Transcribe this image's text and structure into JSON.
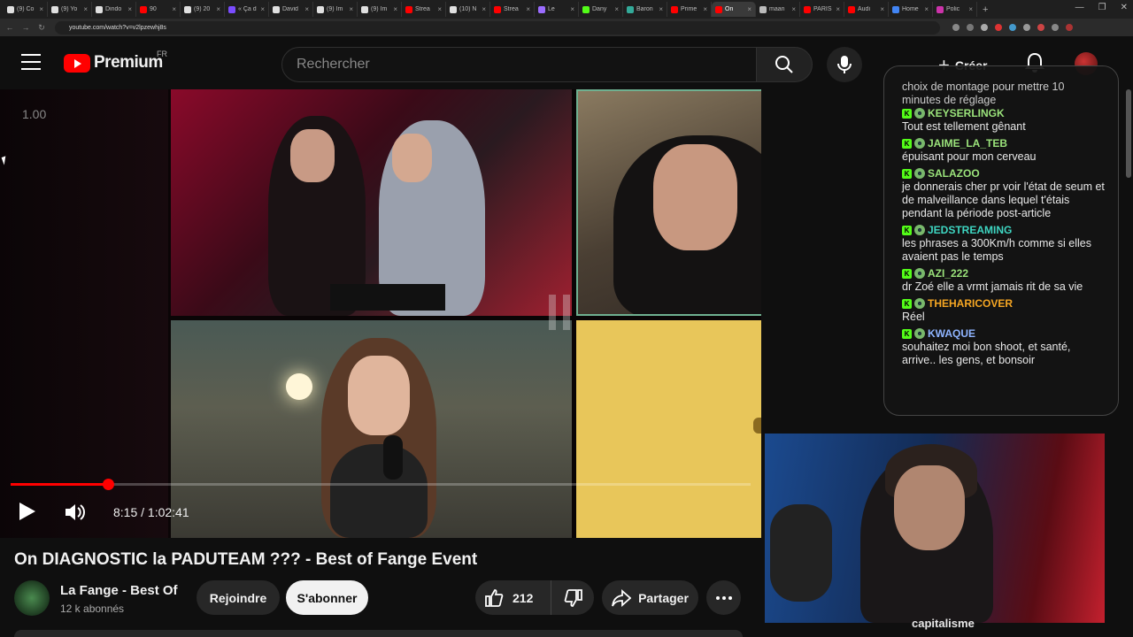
{
  "browser": {
    "tabs": [
      {
        "title": "(9) Co",
        "color": "#e0e0e0"
      },
      {
        "title": "(9) Yo",
        "color": "#e0e0e0"
      },
      {
        "title": "Dindo",
        "color": "#e0e0e0"
      },
      {
        "title": "90",
        "color": "#ff0000"
      },
      {
        "title": "(9) 20",
        "color": "#e0e0e0"
      },
      {
        "title": "« Ça d",
        "color": "#7a4cff"
      },
      {
        "title": "David",
        "color": "#e0e0e0"
      },
      {
        "title": "(9) Im",
        "color": "#e0e0e0"
      },
      {
        "title": "(9) Im",
        "color": "#e0e0e0"
      },
      {
        "title": "Strea",
        "color": "#ff0000"
      },
      {
        "title": "(10) N",
        "color": "#e0e0e0"
      },
      {
        "title": "Strea",
        "color": "#ff0000"
      },
      {
        "title": "Le",
        "color": "#9b6cff"
      },
      {
        "title": "Dany",
        "color": "#53fc18"
      },
      {
        "title": "Baron",
        "color": "#3a9"
      },
      {
        "title": "Prime",
        "color": "#ff0000"
      },
      {
        "title": "On",
        "color": "#ff0000",
        "active": true
      },
      {
        "title": "maan",
        "color": "#bbbbbb"
      },
      {
        "title": "PARIS",
        "color": "#ff0000"
      },
      {
        "title": "Audi",
        "color": "#ff0000"
      },
      {
        "title": "Home",
        "color": "#4285f4"
      },
      {
        "title": "Polic",
        "color": "#c3a"
      }
    ],
    "url": "youtube.com/watch?v=v2lpzewhj8s"
  },
  "header": {
    "logo_text": "Premium",
    "region": "FR",
    "search_placeholder": "Rechercher",
    "create_label": "Créer"
  },
  "player": {
    "speed": "1.00",
    "time": "8:15 / 1:02:41",
    "progress_fraction": 0.1315
  },
  "chat": {
    "cut_text": "choix de montage pour mettre 10 minutes de réglage",
    "messages": [
      {
        "user": "KEYSERLINGK",
        "color": "#9be37b",
        "text": "Tout est tellement gênant"
      },
      {
        "user": "JAIME_LA_TEB",
        "color": "#9be37b",
        "text": "épuisant pour mon cerveau"
      },
      {
        "user": "SALAZOO",
        "color": "#9be37b",
        "text": "je donnerais cher pr voir l'état de seum et de malveillance dans lequel t'étais pendant la période post-article"
      },
      {
        "user": "JEDSTREAMING",
        "color": "#3ed6c2",
        "text": "les phrases a 300Km/h comme si elles avaient pas le temps"
      },
      {
        "user": "AZI_222",
        "color": "#9be37b",
        "text": "dr Zoé elle a vrmt jamais rit de sa vie"
      },
      {
        "user": "THEHARICOVER",
        "color": "#f5a623",
        "text": "Réel"
      },
      {
        "user": "KWAQUE",
        "color": "#8fb4ff",
        "text": "souhaitez moi bon shoot, et santé, arrive.. les gens, et bonsoir"
      }
    ]
  },
  "webcam": {
    "caption": "capitalisme"
  },
  "video": {
    "title": "On DIAGNOSTIC la PADUTEAM ??? - Best of Fange Event",
    "channel_name": "La Fange - Best Of",
    "channel_subs": "12 k abonnés",
    "join_label": "Rejoindre",
    "subscribe_label": "S'abonner",
    "like_count": "212",
    "share_label": "Partager"
  }
}
